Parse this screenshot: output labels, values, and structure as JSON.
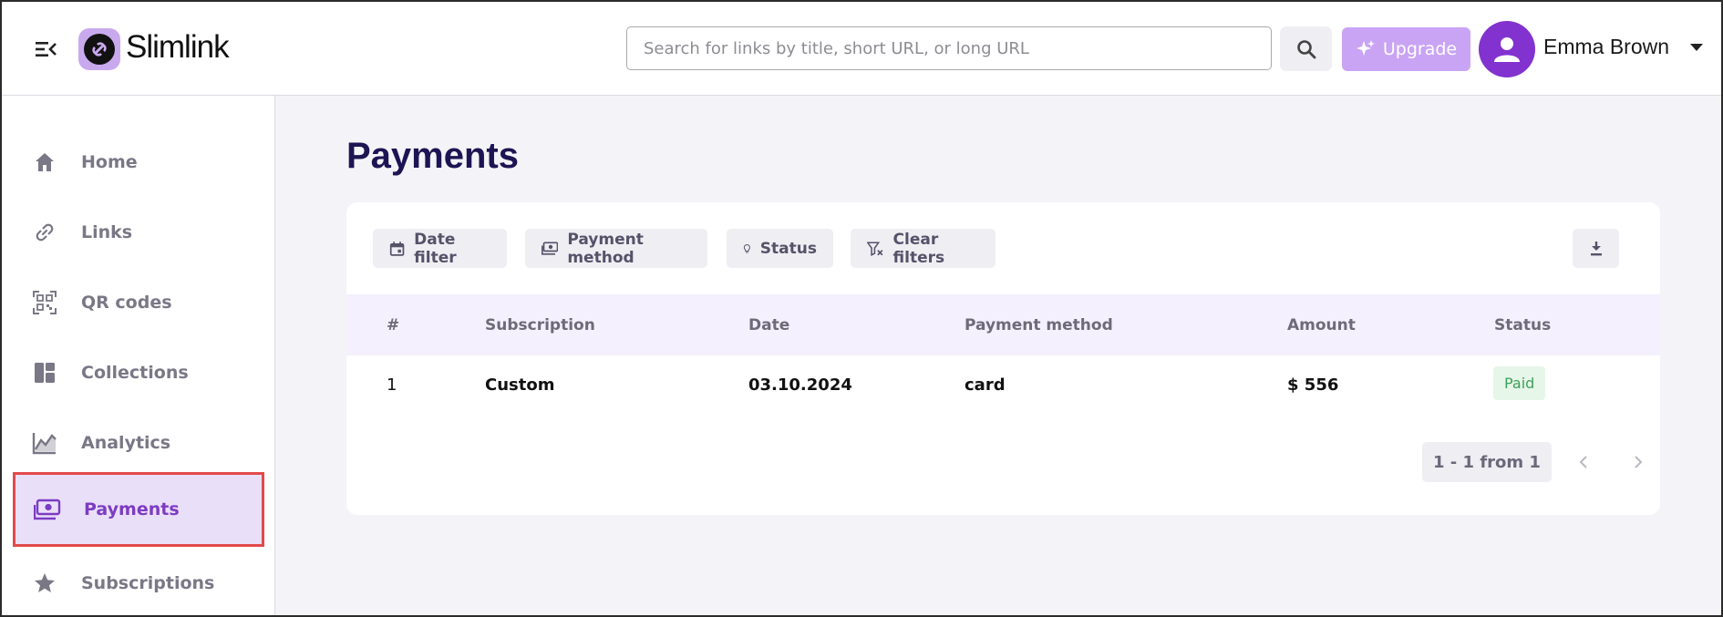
{
  "app": {
    "brand": "Slimlink"
  },
  "header": {
    "search_placeholder": "Search for links by title, short URL, or long URL",
    "upgrade_label": "Upgrade",
    "user_name": "Emma Brown"
  },
  "sidebar": {
    "items": [
      {
        "label": "Home",
        "icon": "home-icon"
      },
      {
        "label": "Links",
        "icon": "link-icon"
      },
      {
        "label": "QR codes",
        "icon": "qr-code-icon"
      },
      {
        "label": "Collections",
        "icon": "collections-icon"
      },
      {
        "label": "Analytics",
        "icon": "analytics-icon"
      },
      {
        "label": "Payments",
        "icon": "payments-icon",
        "active": true
      },
      {
        "label": "Subscriptions",
        "icon": "star-icon"
      }
    ]
  },
  "main": {
    "title": "Payments",
    "filters": {
      "date": "Date filter",
      "payment_method": "Payment method",
      "status": "Status",
      "clear": "Clear filters"
    },
    "table": {
      "columns": [
        "#",
        "Subscription",
        "Date",
        "Payment method",
        "Amount",
        "Status"
      ],
      "rows": [
        [
          "1",
          "Custom",
          "03.10.2024",
          "card",
          "$ 556",
          "Paid"
        ]
      ]
    },
    "pagination": "1 - 1 from 1"
  },
  "colors": {
    "accent": "#8232cf",
    "active_bg": "#eadff9",
    "paid_bg": "#e6f6e9",
    "paid_text": "#3ea25a",
    "title": "#1d1553"
  }
}
